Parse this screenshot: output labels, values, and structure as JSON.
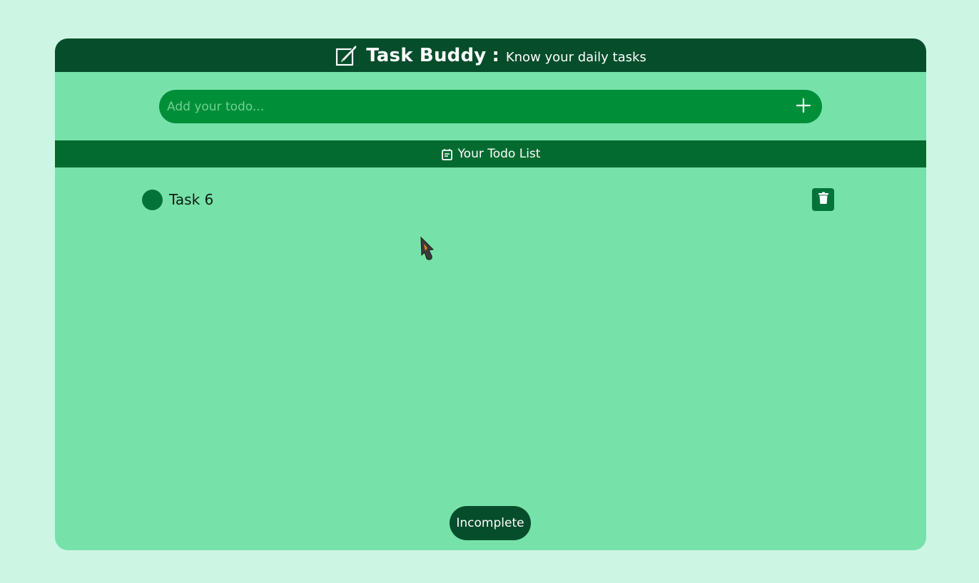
{
  "header": {
    "title": "Task Buddy",
    "separator": ":",
    "subtitle": "Know your daily tasks",
    "logo_icon": "edit-note-icon"
  },
  "todo_input": {
    "placeholder": "Add your todo...",
    "value": "",
    "add_icon": "plus-icon"
  },
  "list": {
    "heading": "Your Todo List",
    "heading_icon": "calendar-icon",
    "items": [
      {
        "label": "Task 6",
        "status": "incomplete"
      }
    ]
  },
  "footer": {
    "status_button_label": "Incomplete"
  },
  "colors": {
    "page_background": "#cdf5e4",
    "card_background": "#76e2a9",
    "header_background": "#064d2b",
    "input_background": "#008f39",
    "list_header_background": "#036b2f",
    "accent_dark": "#03733a"
  }
}
